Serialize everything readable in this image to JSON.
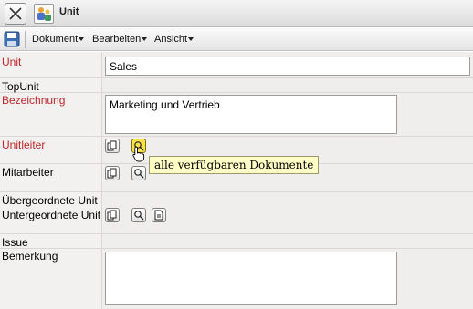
{
  "window": {
    "title": "Unit"
  },
  "toolbar": {
    "menus": [
      {
        "label": "Dokument"
      },
      {
        "label": "Bearbeiten"
      },
      {
        "label": "Ansicht"
      }
    ]
  },
  "form": {
    "fields": {
      "unit": {
        "label": "Unit",
        "value": "Sales",
        "required": true
      },
      "topunit": {
        "label": "TopUnit"
      },
      "bezeichnung": {
        "label": "Bezeichnung",
        "value": "Marketing und Vertrieb",
        "required": true
      },
      "unitleiter": {
        "label": "Unitleiter",
        "required": true
      },
      "mitarbeiter": {
        "label": "Mitarbeiter"
      },
      "uebergeordnete": {
        "label": "Übergeordnete Unit"
      },
      "untergeordnete": {
        "label": "Untergeordnete Unit"
      },
      "issue": {
        "label": "Issue"
      },
      "bemerkung": {
        "label": "Bemerkung",
        "value": ""
      }
    }
  },
  "tooltip": {
    "text": "alle verfügbaren Dokumente"
  },
  "colors": {
    "required_label": "#c0282b",
    "tooltip_bg": "#ffffc6",
    "active_button": "#f8e24a"
  },
  "icons": [
    "close-icon",
    "unit-icon",
    "save-icon",
    "copy-icon",
    "search-icon",
    "document-icon",
    "hand-cursor-icon"
  ]
}
